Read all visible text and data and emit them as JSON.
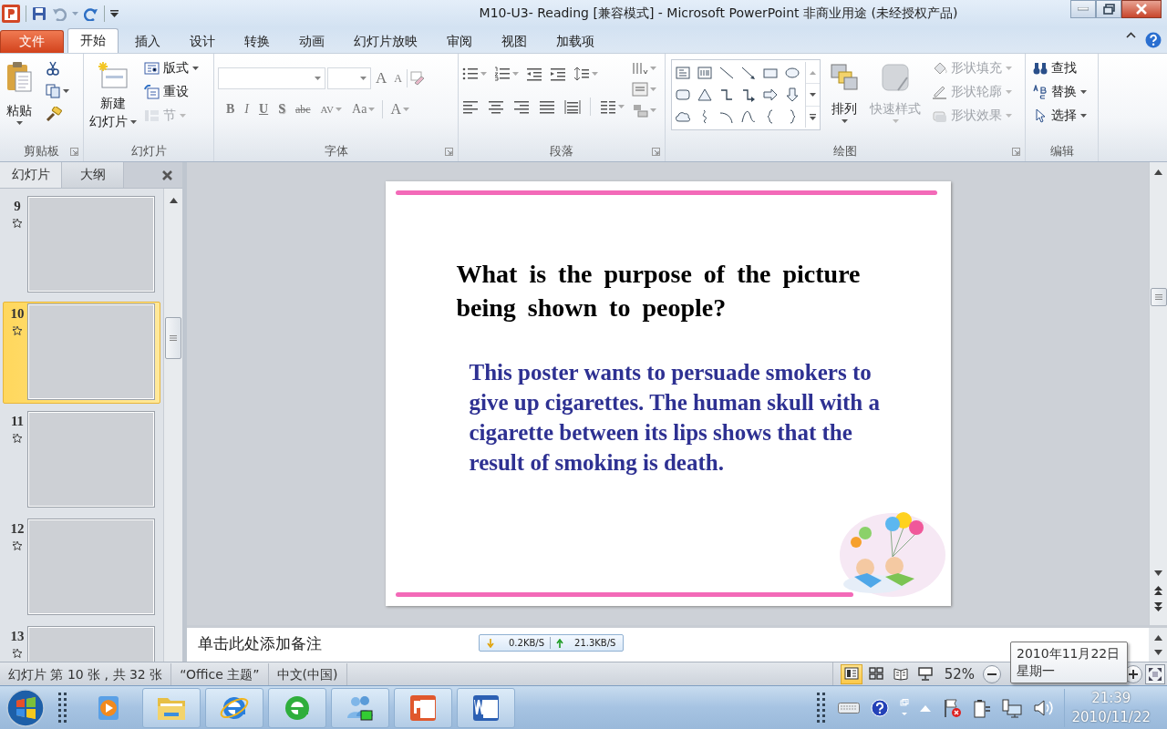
{
  "window": {
    "title": "M10-U3- Reading [兼容模式] - Microsoft PowerPoint 非商业用途 (未经授权产品)"
  },
  "ribbon": {
    "tabs": [
      {
        "label": "文件",
        "kind": "file",
        "selected": false
      },
      {
        "label": "开始",
        "kind": "tab",
        "selected": true
      },
      {
        "label": "插入",
        "kind": "tab",
        "selected": false
      },
      {
        "label": "设计",
        "kind": "tab",
        "selected": false
      },
      {
        "label": "转换",
        "kind": "tab",
        "selected": false
      },
      {
        "label": "动画",
        "kind": "tab",
        "selected": false
      },
      {
        "label": "幻灯片放映",
        "kind": "tab",
        "selected": false
      },
      {
        "label": "审阅",
        "kind": "tab",
        "selected": false
      },
      {
        "label": "视图",
        "kind": "tab",
        "selected": false
      },
      {
        "label": "加载项",
        "kind": "tab",
        "selected": false
      }
    ],
    "clipboard": {
      "label": "剪贴板",
      "paste": "粘贴"
    },
    "slides": {
      "label": "幻灯片",
      "new_slide": [
        "新建",
        "幻灯片"
      ],
      "commands": [
        {
          "label": "版式",
          "dropdown": true,
          "disabled": false
        },
        {
          "label": "重设",
          "dropdown": false,
          "disabled": false
        },
        {
          "label": "节",
          "dropdown": true,
          "disabled": true
        }
      ]
    },
    "font": {
      "label": "字体",
      "grow": "A",
      "shrink": "A",
      "format_buttons": [
        {
          "label": "B",
          "kind": "bold"
        },
        {
          "label": "I",
          "kind": "italic"
        },
        {
          "label": "U",
          "kind": "underline"
        },
        {
          "label": "S",
          "kind": "shadow"
        },
        {
          "label": "abc",
          "kind": "strikethrough"
        },
        {
          "label": "AV",
          "kind": "spacing"
        },
        {
          "label": "Aa",
          "kind": "case"
        },
        {
          "label": "A",
          "kind": "color"
        }
      ]
    },
    "paragraph": {
      "label": "段落"
    },
    "drawing": {
      "label": "绘图",
      "arrange": "排列",
      "quick_styles": {
        "label": "快速样式",
        "disabled": true
      },
      "commands": [
        {
          "label": "形状填充",
          "disabled": true
        },
        {
          "label": "形状轮廓",
          "disabled": true
        },
        {
          "label": "形状效果",
          "disabled": true
        }
      ]
    },
    "editing": {
      "label": "编辑",
      "commands": [
        {
          "label": "查找",
          "dropdown": false
        },
        {
          "label": "替换",
          "dropdown": true
        },
        {
          "label": "选择",
          "dropdown": true
        }
      ]
    }
  },
  "slides_pane": {
    "tabs": [
      {
        "label": "幻灯片",
        "selected": true
      },
      {
        "label": "大纲",
        "selected": false
      }
    ],
    "thumbnails": [
      {
        "number": "9",
        "animated": true,
        "selected": false
      },
      {
        "number": "10",
        "animated": true,
        "selected": true
      },
      {
        "number": "11",
        "animated": true,
        "selected": false
      },
      {
        "number": "12",
        "animated": true,
        "selected": false
      },
      {
        "number": "13",
        "animated": true,
        "selected": false
      }
    ]
  },
  "slide": {
    "title": "What is the purpose of the picture being shown to people?",
    "body": "This poster wants to persuade smokers to give up cigarettes. The human skull with a cigarette between its lips shows that the result of smoking is death."
  },
  "notes": {
    "placeholder": "单击此处添加备注"
  },
  "network_monitor": {
    "download": "0.2KB/S",
    "upload": "21.3KB/S"
  },
  "status_bar": {
    "items": [
      "幻灯片 第 10 张 , 共 32 张",
      "“Office 主题”",
      "中文(中国)"
    ],
    "views": [
      {
        "selected": true
      },
      {
        "selected": false
      },
      {
        "selected": false
      },
      {
        "selected": false
      }
    ],
    "zoom": "52%"
  },
  "tooltip": {
    "lines": [
      "2010年11月22日",
      "星期一"
    ]
  },
  "taskbar": {
    "clock": {
      "time": "21:39",
      "date": "2010/11/22"
    }
  }
}
